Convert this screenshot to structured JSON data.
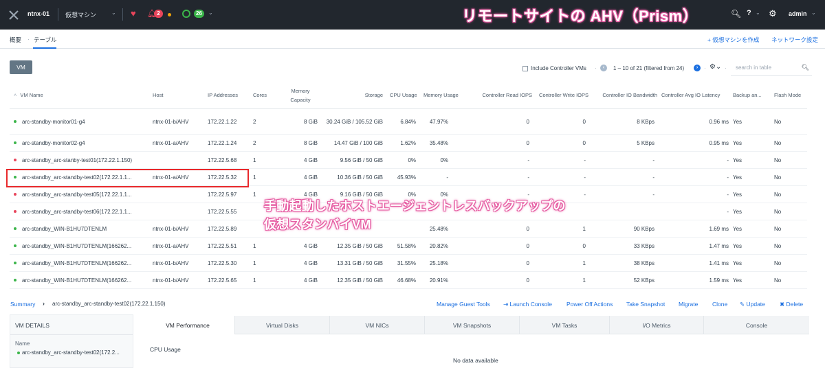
{
  "topbar": {
    "cluster_name": "ntnx-01",
    "entity_menu": "仮想マシン",
    "alert_count": "2",
    "task_count": "26",
    "overlay_title": "リモートサイトの AHV（Prism）",
    "user": "admin"
  },
  "subnav": {
    "tab_overview": "概要",
    "tab_table": "テーブル",
    "create_vm": "+ 仮想マシンを作成",
    "network_config": "ネットワーク設定"
  },
  "toolbar": {
    "vm_button": "VM",
    "include_controller": "Include Controller VMs",
    "pagination": "1 – 10 of 21 (filtered from 24)",
    "search_placeholder": "search in table"
  },
  "table": {
    "headers": {
      "vm_name": "VM Name",
      "host": "Host",
      "ip": "IP Addresses",
      "cores": "Cores",
      "memory": "Memory Capacity",
      "storage": "Storage",
      "cpu": "CPU Usage",
      "mem_usage": "Memory Usage",
      "read_iops": "Controller Read IOPS",
      "write_iops": "Controller Write IOPS",
      "bandwidth": "Controller IO Bandwidth",
      "latency": "Controller Avg IO Latency",
      "backup": "Backup an...",
      "flash": "Flash Mode"
    },
    "rows": [
      {
        "status": "#3bb54a",
        "name": "arc-standby-monitor01-g4",
        "host": "ntnx-01-b/AHV",
        "ip": "172.22.1.22",
        "cores": "2",
        "mem": "8 GiB",
        "storage": "30.24 GiB / 105.52 GiB",
        "cpu": "6.84%",
        "mem_usage": "47.97%",
        "read_iops": "0",
        "write_iops": "0",
        "bw": "8 KBps",
        "lat": "0.96 ms",
        "backup": "Yes",
        "flash": "No"
      },
      {
        "status": "#3bb54a",
        "name": "arc-standby-monitor02-g4",
        "host": "ntnx-01-a/AHV",
        "ip": "172.22.1.24",
        "cores": "2",
        "mem": "8 GiB",
        "storage": "14.47 GiB / 100 GiB",
        "cpu": "1.62%",
        "mem_usage": "35.48%",
        "read_iops": "0",
        "write_iops": "0",
        "bw": "5 KBps",
        "lat": "0.95 ms",
        "backup": "Yes",
        "flash": "No"
      },
      {
        "status": "#e8455b",
        "name": "arc-standby_arc-stanby-test01(172.22.1.150)",
        "host": "",
        "ip": "172.22.5.68",
        "cores": "1",
        "mem": "4 GiB",
        "storage": "9.56 GiB / 50 GiB",
        "cpu": "0%",
        "mem_usage": "0%",
        "read_iops": "-",
        "write_iops": "-",
        "bw": "-",
        "lat": "-",
        "backup": "Yes",
        "flash": "No"
      },
      {
        "status": "#3bb54a",
        "name": "arc-standby_arc-standby-test02(172.22.1.1...",
        "host": "ntnx-01-a/AHV",
        "ip": "172.22.5.32",
        "cores": "1",
        "mem": "4 GiB",
        "storage": "10.36 GiB / 50 GiB",
        "cpu": "45.93%",
        "mem_usage": "-",
        "read_iops": "-",
        "write_iops": "-",
        "bw": "-",
        "lat": "-",
        "backup": "Yes",
        "flash": "No"
      },
      {
        "status": "#e8455b",
        "name": "arc-standby_arc-standby-test05(172.22.1.1...",
        "host": "",
        "ip": "172.22.5.97",
        "cores": "1",
        "mem": "4 GiB",
        "storage": "9.16 GiB / 50 GiB",
        "cpu": "0%",
        "mem_usage": "0%",
        "read_iops": "-",
        "write_iops": "-",
        "bw": "-",
        "lat": "-",
        "backup": "Yes",
        "flash": "No"
      },
      {
        "status": "#e8455b",
        "name": "arc-standby_arc-standby-test06(172.22.1.1...",
        "host": "",
        "ip": "172.22.5.55",
        "cores": "",
        "mem": "",
        "storage": "",
        "cpu": "",
        "mem_usage": "",
        "read_iops": "",
        "write_iops": "",
        "bw": "",
        "lat": "-",
        "backup": "Yes",
        "flash": "No"
      },
      {
        "status": "#3bb54a",
        "name": "arc-standby_WIN-B1HU7DTENLM",
        "host": "ntnx-01-b/AHV",
        "ip": "172.22.5.89",
        "cores": "",
        "mem": "",
        "storage": "",
        "cpu": "",
        "mem_usage": "25.48%",
        "read_iops": "0",
        "write_iops": "1",
        "bw": "90 KBps",
        "lat": "1.69 ms",
        "backup": "Yes",
        "flash": "No"
      },
      {
        "status": "#3bb54a",
        "name": "arc-standby_WIN-B1HU7DTENLM(166262...",
        "host": "ntnx-01-a/AHV",
        "ip": "172.22.5.51",
        "cores": "1",
        "mem": "4 GiB",
        "storage": "12.35 GiB / 50 GiB",
        "cpu": "51.58%",
        "mem_usage": "20.82%",
        "read_iops": "0",
        "write_iops": "0",
        "bw": "33 KBps",
        "lat": "1.47 ms",
        "backup": "Yes",
        "flash": "No"
      },
      {
        "status": "#3bb54a",
        "name": "arc-standby_WIN-B1HU7DTENLM(166262...",
        "host": "ntnx-01-b/AHV",
        "ip": "172.22.5.30",
        "cores": "1",
        "mem": "4 GiB",
        "storage": "13.31 GiB / 50 GiB",
        "cpu": "31.55%",
        "mem_usage": "25.18%",
        "read_iops": "0",
        "write_iops": "1",
        "bw": "38 KBps",
        "lat": "1.41 ms",
        "backup": "Yes",
        "flash": "No"
      },
      {
        "status": "#3bb54a",
        "name": "arc-standby_WIN-B1HU7DTENLM(166262...",
        "host": "ntnx-01-b/AHV",
        "ip": "172.22.5.65",
        "cores": "1",
        "mem": "4 GiB",
        "storage": "12.35 GiB / 50 GiB",
        "cpu": "46.68%",
        "mem_usage": "20.91%",
        "read_iops": "0",
        "write_iops": "1",
        "bw": "52 KBps",
        "lat": "1.59 ms",
        "backup": "Yes",
        "flash": "No"
      }
    ]
  },
  "overlay_caption_line1": "手動起動したホストエージェントレスバックアップの",
  "overlay_caption_line2": "仮想スタンバイVM",
  "summary": {
    "link": "Summary",
    "vm": "arc-standby_arc-standby-test02(172.22.1.150)",
    "actions": [
      "Manage Guest Tools",
      "Launch Console",
      "Power Off Actions",
      "Take Snapshot",
      "Migrate",
      "Clone",
      "Update",
      "Delete"
    ]
  },
  "details": {
    "heading": "VM DETAILS",
    "name_label": "Name",
    "name_value": "arc-standby_arc-standby-test02(172.2..."
  },
  "panel_tabs": [
    "VM Performance",
    "Virtual Disks",
    "VM NICs",
    "VM Snapshots",
    "VM Tasks",
    "I/O Metrics",
    "Console"
  ],
  "cpu_usage_label": "CPU Usage",
  "no_data": "No data available"
}
